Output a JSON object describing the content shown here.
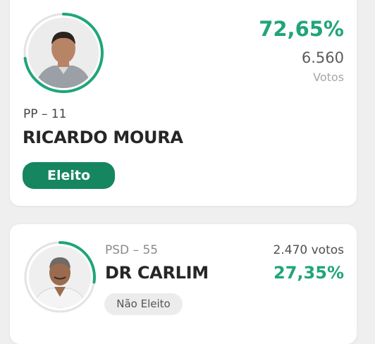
{
  "candidates": [
    {
      "party": "PP – 11",
      "name": "RICARDO MOURA",
      "percent": "72,65%",
      "votes": "6.560",
      "votes_label": "Votos",
      "status": "Eleito",
      "percent_value": 72.65
    },
    {
      "party": "PSD – 55",
      "name": "DR CARLIM",
      "percent": "27,35%",
      "votes": "2.470 votos",
      "status": "Não Eleito",
      "percent_value": 27.35
    }
  ],
  "colors": {
    "accent": "#1fa57a",
    "elected_badge": "#15865f",
    "not_elected_badge": "#ececec"
  }
}
